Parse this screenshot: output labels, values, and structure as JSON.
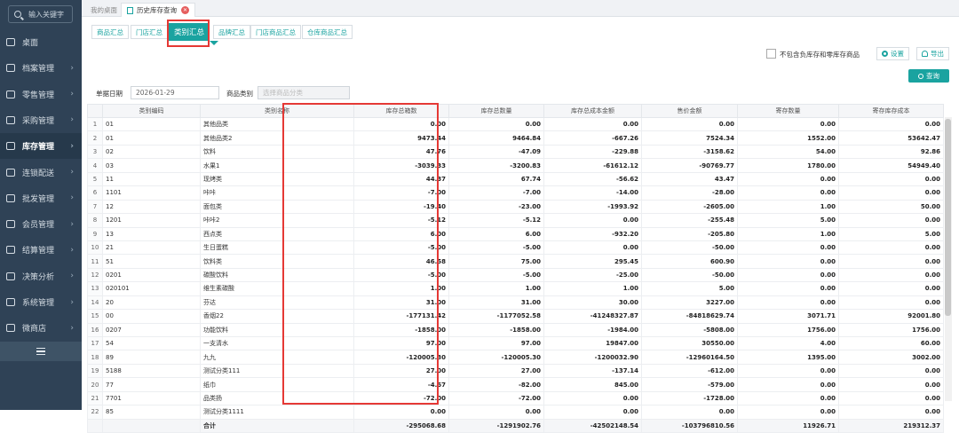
{
  "sidebar": {
    "search_placeholder": "输入关键字",
    "items": [
      {
        "label": "桌面",
        "arrow": false,
        "icon": "monitor-icon"
      },
      {
        "label": "档案管理",
        "arrow": true,
        "icon": "archive-icon"
      },
      {
        "label": "零售管理",
        "arrow": true,
        "icon": "retail-icon"
      },
      {
        "label": "采购管理",
        "arrow": true,
        "icon": "purchase-icon"
      },
      {
        "label": "库存管理",
        "arrow": true,
        "icon": "inventory-icon",
        "active": true
      },
      {
        "label": "连锁配送",
        "arrow": true,
        "icon": "delivery-icon"
      },
      {
        "label": "批发管理",
        "arrow": true,
        "icon": "wholesale-icon"
      },
      {
        "label": "会员管理",
        "arrow": true,
        "icon": "member-icon"
      },
      {
        "label": "结算管理",
        "arrow": true,
        "icon": "settlement-icon"
      },
      {
        "label": "决策分析",
        "arrow": true,
        "icon": "analysis-icon"
      },
      {
        "label": "系统管理",
        "arrow": true,
        "icon": "settings-icon"
      },
      {
        "label": "微商店",
        "arrow": true,
        "icon": "shop-icon"
      }
    ]
  },
  "top_tabs": {
    "home": "我的桌面",
    "current": "历史库存查询"
  },
  "sub_tabs": [
    "商品汇总",
    "门店汇总",
    "类别汇总",
    "品牌汇总",
    "门店商品汇总",
    "仓库商品汇总"
  ],
  "sub_tab_active": "类别汇总",
  "options": {
    "exclude_label": "不包含负库存和零库存商品",
    "settings_label": "设置",
    "export_label": "导出",
    "query_label": "查询"
  },
  "filters": {
    "date_label": "单据日期",
    "date_value": "2026-01-29",
    "category_label": "商品类别",
    "category_placeholder": "选择商品分类"
  },
  "table": {
    "columns": [
      "类别编码",
      "类别名称",
      "库存总箱数",
      "库存总数量",
      "库存总成本金额",
      "售价金额",
      "寄存数量",
      "寄存库存成本"
    ],
    "rows": [
      [
        "1",
        "01",
        "其他品类",
        "0.00",
        "0.00",
        "0.00",
        "0.00",
        "0.00",
        "0.00"
      ],
      [
        "2",
        "01",
        "其他品类2",
        "9473.44",
        "9464.84",
        "-667.26",
        "7524.34",
        "1552.00",
        "53642.47"
      ],
      [
        "3",
        "02",
        "饮料",
        "47.76",
        "-47.09",
        "-229.88",
        "-3158.62",
        "54.00",
        "92.86"
      ],
      [
        "4",
        "03",
        "水果1",
        "-3039.33",
        "-3200.83",
        "-61612.12",
        "-90769.77",
        "1780.00",
        "54949.40"
      ],
      [
        "5",
        "11",
        "现烤类",
        "44.37",
        "67.74",
        "-56.62",
        "43.47",
        "0.00",
        "0.00"
      ],
      [
        "6",
        "1101",
        "咔咔",
        "-7.00",
        "-7.00",
        "-14.00",
        "-28.00",
        "0.00",
        "0.00"
      ],
      [
        "7",
        "12",
        "面包类",
        "-19.40",
        "-23.00",
        "-1993.92",
        "-2605.00",
        "1.00",
        "50.00"
      ],
      [
        "8",
        "1201",
        "咔咔2",
        "-5.12",
        "-5.12",
        "0.00",
        "-255.48",
        "5.00",
        "0.00"
      ],
      [
        "9",
        "13",
        "西点类",
        "6.00",
        "6.00",
        "-932.20",
        "-205.80",
        "1.00",
        "5.00"
      ],
      [
        "10",
        "21",
        "生日蛋糕",
        "-5.00",
        "-5.00",
        "0.00",
        "-50.00",
        "0.00",
        "0.00"
      ],
      [
        "11",
        "51",
        "饮料类",
        "46.58",
        "75.00",
        "295.45",
        "600.90",
        "0.00",
        "0.00"
      ],
      [
        "12",
        "0201",
        "碳酸饮料",
        "-5.00",
        "-5.00",
        "-25.00",
        "-50.00",
        "0.00",
        "0.00"
      ],
      [
        "13",
        "020101",
        "维生素碳酸",
        "1.00",
        "1.00",
        "1.00",
        "5.00",
        "0.00",
        "0.00"
      ],
      [
        "14",
        "20",
        "芬达",
        "31.00",
        "31.00",
        "30.00",
        "3227.00",
        "0.00",
        "0.00"
      ],
      [
        "15",
        "00",
        "香烟22",
        "-177131.42",
        "-1177052.58",
        "-41248327.87",
        "-84818629.74",
        "3071.71",
        "92001.80"
      ],
      [
        "16",
        "0207",
        "功能饮料",
        "-1858.00",
        "-1858.00",
        "-1984.00",
        "-5808.00",
        "1756.00",
        "1756.00"
      ],
      [
        "17",
        "54",
        "一支清水",
        "97.00",
        "97.00",
        "19847.00",
        "30550.00",
        "4.00",
        "60.00"
      ],
      [
        "18",
        "89",
        "九九",
        "-120005.30",
        "-120005.30",
        "-1200032.90",
        "-12960164.50",
        "1395.00",
        "3002.00"
      ],
      [
        "19",
        "5188",
        "测试分类111",
        "27.00",
        "27.00",
        "-137.14",
        "-612.00",
        "0.00",
        "0.00"
      ],
      [
        "20",
        "77",
        "纸巾",
        "-4.67",
        "-82.00",
        "845.00",
        "-579.00",
        "0.00",
        "0.00"
      ],
      [
        "21",
        "7701",
        "品类扬",
        "-72.00",
        "-72.00",
        "0.00",
        "-1728.00",
        "0.00",
        "0.00"
      ],
      [
        "22",
        "85",
        "测试分类1111",
        "0.00",
        "0.00",
        "0.00",
        "0.00",
        "0.00",
        "0.00"
      ]
    ],
    "total": {
      "label": "合计",
      "values": [
        "-295068.68",
        "-1291902.76",
        "-42502148.54",
        "-103796810.56",
        "11926.71",
        "219312.37"
      ]
    }
  },
  "colors": {
    "accent": "#1aa3a0",
    "sidebar": "#2f4256",
    "highlight": "#e53935"
  }
}
